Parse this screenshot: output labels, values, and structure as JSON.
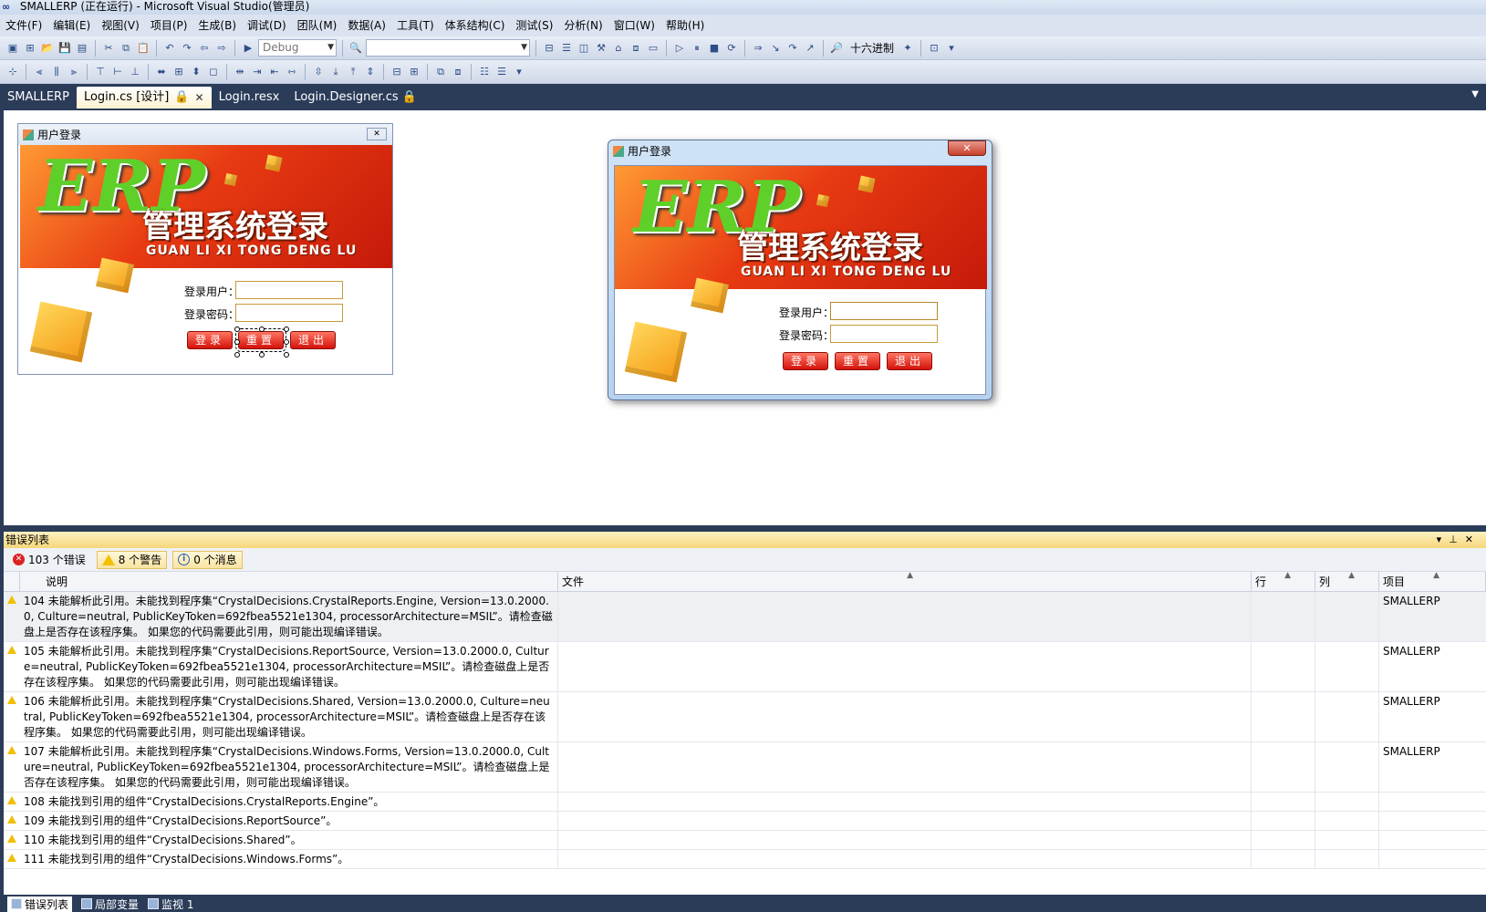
{
  "window": {
    "title": "SMALLERP (正在运行) - Microsoft Visual Studio(管理员)"
  },
  "menu": [
    "文件(F)",
    "编辑(E)",
    "视图(V)",
    "项目(P)",
    "生成(B)",
    "调试(D)",
    "团队(M)",
    "数据(A)",
    "工具(T)",
    "体系结构(C)",
    "测试(S)",
    "分析(N)",
    "窗口(W)",
    "帮助(H)"
  ],
  "toolbar": {
    "config": "Debug",
    "hex_label": "十六进制"
  },
  "tabs": [
    {
      "label": "SMALLERP"
    },
    {
      "label": "Login.cs [设计]"
    },
    {
      "label": "Login.resx"
    },
    {
      "label": "Login.Designer.cs"
    }
  ],
  "designer": {
    "form_title": "用户登录",
    "banner_big": "ERP",
    "banner_cn": "管理系统登录",
    "banner_pinyin": "GUAN LI XI TONG DENG LU",
    "user_label": "登录用户：",
    "pwd_label": "登录密码：",
    "btn_login": "登录",
    "btn_reset": "重置",
    "btn_exit": "退出"
  },
  "running": {
    "form_title": "用户登录",
    "banner_big": "ERP",
    "banner_cn": "管理系统登录",
    "banner_pinyin": "GUAN LI XI TONG DENG LU",
    "user_label": "登录用户：",
    "pwd_label": "登录密码：",
    "btn_login": "登录",
    "btn_reset": "重置",
    "btn_exit": "退出"
  },
  "error_list": {
    "title": "错误列表",
    "errors": "103 个错误",
    "warnings": "8 个警告",
    "messages": "0 个消息",
    "columns": [
      "说明",
      "文件",
      "行",
      "列",
      "项目"
    ],
    "rows": [
      {
        "num": "104",
        "desc": "未能解析此引用。未能找到程序集“CrystalDecisions.CrystalReports.Engine, Version=13.0.2000.0, Culture=neutral, PublicKeyToken=692fbea5521e1304, processorArchitecture=MSIL”。请检查磁盘上是否存在该程序集。 如果您的代码需要此引用，则可能出现编译错误。",
        "project": "SMALLERP"
      },
      {
        "num": "105",
        "desc": "未能解析此引用。未能找到程序集“CrystalDecisions.ReportSource, Version=13.0.2000.0, Culture=neutral, PublicKeyToken=692fbea5521e1304, processorArchitecture=MSIL”。请检查磁盘上是否存在该程序集。 如果您的代码需要此引用，则可能出现编译错误。",
        "project": "SMALLERP"
      },
      {
        "num": "106",
        "desc": "未能解析此引用。未能找到程序集“CrystalDecisions.Shared, Version=13.0.2000.0, Culture=neutral, PublicKeyToken=692fbea5521e1304, processorArchitecture=MSIL”。请检查磁盘上是否存在该程序集。 如果您的代码需要此引用，则可能出现编译错误。",
        "project": "SMALLERP"
      },
      {
        "num": "107",
        "desc": "未能解析此引用。未能找到程序集“CrystalDecisions.Windows.Forms, Version=13.0.2000.0, Culture=neutral, PublicKeyToken=692fbea5521e1304, processorArchitecture=MSIL”。请检查磁盘上是否存在该程序集。 如果您的代码需要此引用，则可能出现编译错误。",
        "project": "SMALLERP"
      },
      {
        "num": "108",
        "desc": "未能找到引用的组件“CrystalDecisions.CrystalReports.Engine”。",
        "project": ""
      },
      {
        "num": "109",
        "desc": "未能找到引用的组件“CrystalDecisions.ReportSource”。",
        "project": ""
      },
      {
        "num": "110",
        "desc": "未能找到引用的组件“CrystalDecisions.Shared”。",
        "project": ""
      },
      {
        "num": "111",
        "desc": "未能找到引用的组件“CrystalDecisions.Windows.Forms”。",
        "project": ""
      }
    ]
  },
  "bottom_tabs": [
    "错误列表",
    "局部变量",
    "监视 1"
  ]
}
